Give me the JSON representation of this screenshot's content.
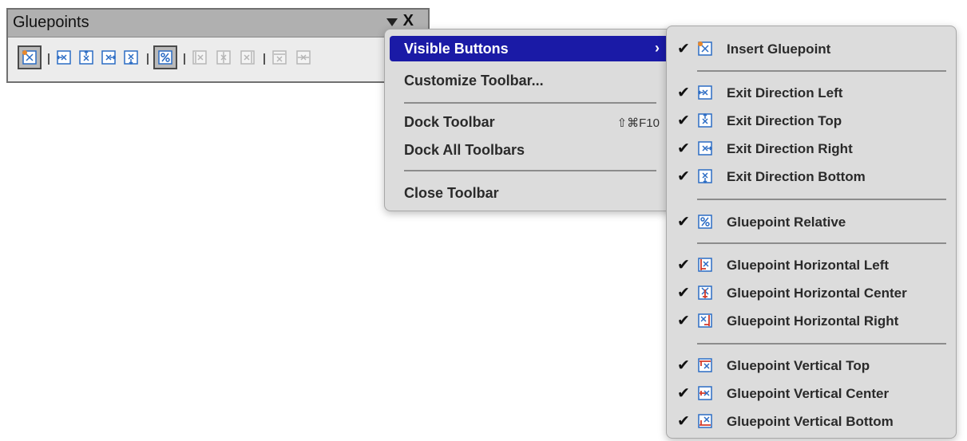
{
  "toolbar": {
    "title": "Gluepoints",
    "menu_button_icon": "triangle-down-icon",
    "close_button_label": "X",
    "buttons": [
      {
        "name": "insert-gluepoint-button",
        "icon": "insert-gluepoint-icon",
        "state": "active"
      },
      {
        "name": "exit-direction-left-button",
        "icon": "exit-left-icon",
        "state": "normal"
      },
      {
        "name": "exit-direction-top-button",
        "icon": "exit-top-icon",
        "state": "normal"
      },
      {
        "name": "exit-direction-right-button",
        "icon": "exit-right-icon",
        "state": "normal"
      },
      {
        "name": "exit-direction-bottom-button",
        "icon": "exit-bottom-icon",
        "state": "normal"
      },
      {
        "name": "gluepoint-relative-button",
        "icon": "percent-icon",
        "state": "active"
      },
      {
        "name": "gluepoint-horizontal-left-button",
        "icon": "horizontal-left-icon",
        "state": "disabled"
      },
      {
        "name": "gluepoint-horizontal-center-button",
        "icon": "horizontal-center-icon",
        "state": "disabled"
      },
      {
        "name": "gluepoint-horizontal-right-button",
        "icon": "horizontal-right-icon",
        "state": "disabled"
      },
      {
        "name": "gluepoint-vertical-top-button",
        "icon": "vertical-top-icon",
        "state": "disabled"
      },
      {
        "name": "gluepoint-vertical-center-button",
        "icon": "vertical-center-icon",
        "state": "disabled"
      }
    ]
  },
  "menu": {
    "items": [
      {
        "label": "Visible Buttons",
        "arrow": "›",
        "highlighted": true
      },
      {
        "label": "Customize Toolbar..."
      },
      {
        "label": "Dock Toolbar",
        "shortcut": "⇧⌘F10"
      },
      {
        "label": "Dock All Toolbars"
      },
      {
        "label": "Close Toolbar"
      }
    ]
  },
  "submenu": {
    "check_glyph": "✔",
    "items": [
      {
        "label": "Insert Gluepoint",
        "checked": true,
        "icon": "insert-gluepoint-icon"
      },
      {
        "label": "Exit Direction Left",
        "checked": true,
        "icon": "exit-left-icon"
      },
      {
        "label": "Exit Direction Top",
        "checked": true,
        "icon": "exit-top-icon"
      },
      {
        "label": "Exit Direction Right",
        "checked": true,
        "icon": "exit-right-icon"
      },
      {
        "label": "Exit Direction Bottom",
        "checked": true,
        "icon": "exit-bottom-icon"
      },
      {
        "label": "Gluepoint Relative",
        "checked": true,
        "icon": "percent-icon"
      },
      {
        "label": "Gluepoint Horizontal Left",
        "checked": true,
        "icon": "horizontal-left-icon"
      },
      {
        "label": "Gluepoint Horizontal Center",
        "checked": true,
        "icon": "horizontal-center-icon"
      },
      {
        "label": "Gluepoint Horizontal Right",
        "checked": true,
        "icon": "horizontal-right-icon"
      },
      {
        "label": "Gluepoint Vertical Top",
        "checked": true,
        "icon": "vertical-top-icon"
      },
      {
        "label": "Gluepoint Vertical Center",
        "checked": true,
        "icon": "vertical-center-icon"
      },
      {
        "label": "Gluepoint Vertical Bottom",
        "checked": true,
        "icon": "vertical-bottom-icon"
      }
    ]
  },
  "colors": {
    "highlight": "#1a1aa6",
    "icon_blue": "#2b6cc4",
    "icon_red": "#d23a2a",
    "icon_orange": "#e8882c"
  }
}
